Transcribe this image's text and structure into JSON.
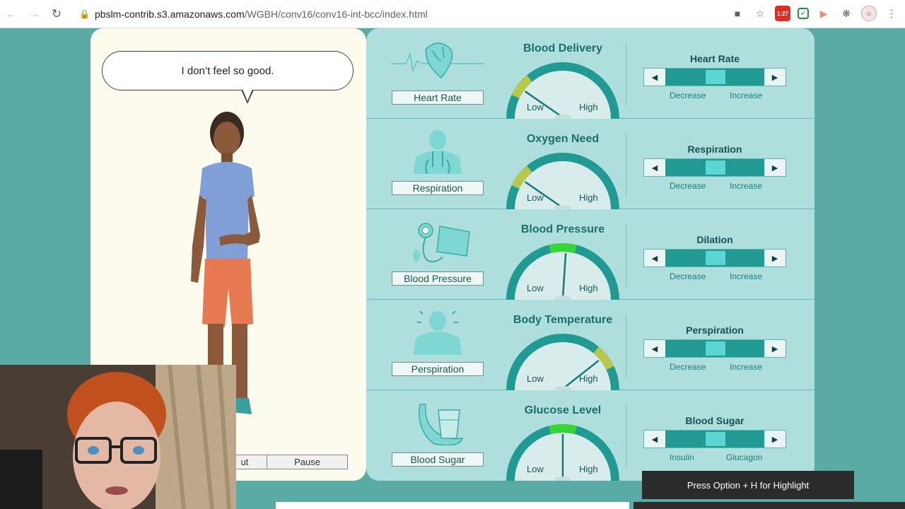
{
  "browser": {
    "url_host": "pbslm-contrib.s3.amazonaws.com",
    "url_path": "/WGBH/conv16/conv16-int-bcc/index.html",
    "calendar_badge": "1:27"
  },
  "character": {
    "speech": "I don’t feel so good."
  },
  "controls": {
    "left_label": "ut",
    "pause_label": "Pause"
  },
  "rows": [
    {
      "icon": "heart-icon",
      "button": "Heart Rate",
      "gauge_title": "Blood Delivery",
      "low": "Low",
      "high": "High",
      "slider_title": "Heart Rate",
      "left_label": "Decrease",
      "right_label": "Increase",
      "highlight": "left",
      "needle_level": 0.2
    },
    {
      "icon": "lungs-icon",
      "button": "Respiration",
      "gauge_title": "Oxygen Need",
      "low": "Low",
      "high": "High",
      "slider_title": "Respiration",
      "left_label": "Decrease",
      "right_label": "Increase",
      "highlight": "left",
      "needle_level": 0.2
    },
    {
      "icon": "blood-pressure-cuff-icon",
      "button": "Blood Pressure",
      "gauge_title": "Blood Pressure",
      "low": "Low",
      "high": "High",
      "slider_title": "Dilation",
      "left_label": "Decrease",
      "right_label": "Increase",
      "highlight": "center",
      "needle_level": 0.52
    },
    {
      "icon": "sweating-person-icon",
      "button": "Perspiration",
      "gauge_title": "Body Temperature",
      "low": "Low",
      "high": "High",
      "slider_title": "Perspiration",
      "left_label": "Decrease",
      "right_label": "Increase",
      "highlight": "right",
      "needle_level": 0.78
    },
    {
      "icon": "banana-glass-icon",
      "button": "Blood Sugar",
      "gauge_title": "Glucose Level",
      "low": "Low",
      "high": "High",
      "slider_title": "Blood Sugar",
      "left_label": "Insulin",
      "right_label": "Glucagon",
      "highlight": "center",
      "needle_level": 0.5
    }
  ],
  "hint": "Press Option + H for Highlight",
  "colors": {
    "page_bg": "#5aaaa6",
    "panel_bg": "#aedfdc",
    "gauge_ring": "#229a94",
    "zone_yellow": "#b8c84a",
    "zone_green": "#36d636",
    "slider_thumb": "#5cd6d4"
  }
}
